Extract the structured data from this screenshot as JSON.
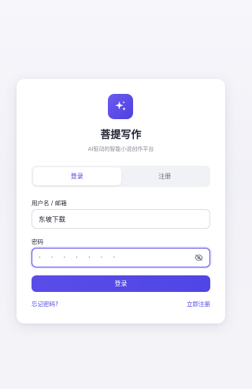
{
  "app": {
    "title": "菩提写作",
    "subtitle": "AI驱动的智能小说创作平台",
    "logo_icon": "sparkles-icon"
  },
  "tabs": [
    {
      "label": "登录",
      "active": true
    },
    {
      "label": "注册",
      "active": false
    }
  ],
  "form": {
    "username_label": "用户名 / 邮箱",
    "username_value": "东坡下载",
    "password_label": "密码",
    "password_mask": "· · · · · · ·",
    "password_toggle_icon": "eye-off-icon",
    "submit_label": "登录"
  },
  "links": {
    "forgot": "忘记密码?",
    "register": "立即注册"
  },
  "colors": {
    "accent": "#4f46e5",
    "background": "#f3f3f8"
  }
}
